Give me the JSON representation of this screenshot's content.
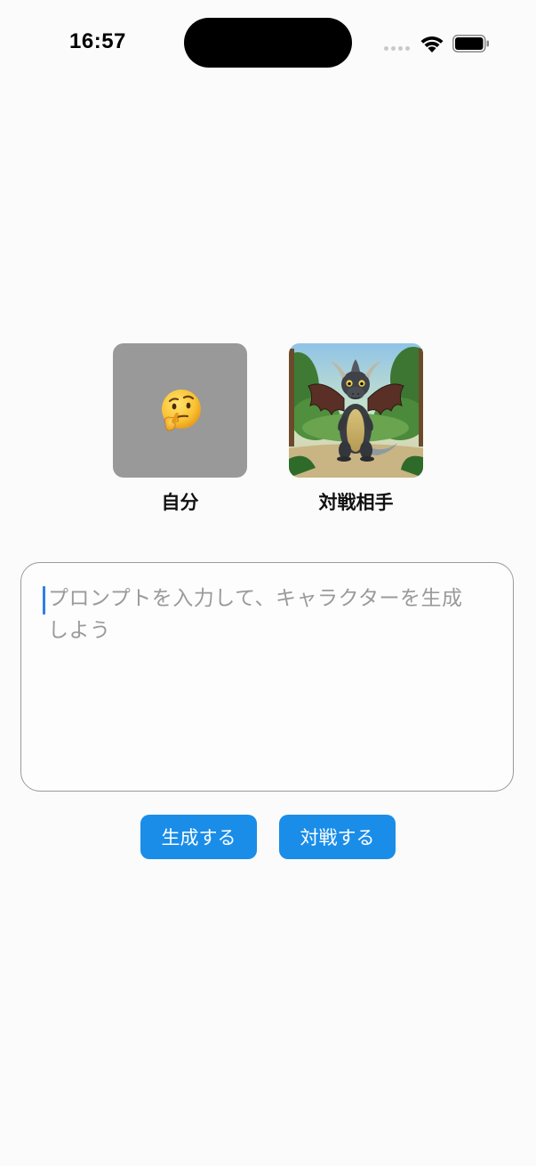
{
  "status_bar": {
    "time": "16:57",
    "icons": [
      "signal-dots-icon",
      "wifi-icon",
      "battery-icon"
    ]
  },
  "characters": {
    "me": {
      "label": "自分",
      "emoji": "🤔",
      "placeholder_color": "#999999"
    },
    "opponent": {
      "label": "対戦相手",
      "image": "dragon-illustration"
    }
  },
  "prompt": {
    "placeholder": "プロンプトを入力して、キャラクターを生成しよう",
    "value": ""
  },
  "buttons": {
    "generate_label": "生成する",
    "battle_label": "対戦する"
  },
  "colors": {
    "accent": "#1a8de8",
    "caret": "#2f7fe6",
    "background": "#fbfbfb"
  }
}
